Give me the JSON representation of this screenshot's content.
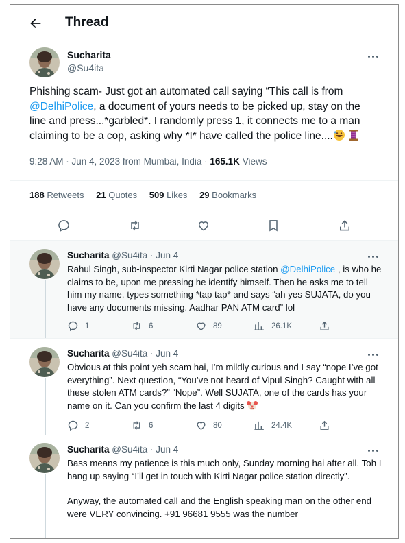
{
  "header": {
    "title": "Thread"
  },
  "main_tweet": {
    "name": "Sucharita",
    "handle": "@Su4ita",
    "text_pre": "Phishing scam- Just got an automated call saying “This call is from ",
    "mention": "@DelhiPolice",
    "text_post": ", a document of yours needs to be picked up, stay on the line and press...*garbled*. I randomly press 1, it connects me to a man claiming to be a cop, asking why *I* have called the police line....",
    "emojis": [
      "rofl-emoji",
      "thread-emoji"
    ],
    "timestamp": "9:28 AM · Jun 4, 2023 from Mumbai, India · ",
    "views_count": "165.1K",
    "views_label": " Views",
    "stats": [
      {
        "count": "188",
        "label": " Retweets"
      },
      {
        "count": "21",
        "label": " Quotes"
      },
      {
        "count": "509",
        "label": " Likes"
      },
      {
        "count": "29",
        "label": " Bookmarks"
      }
    ],
    "actions": [
      "reply-icon",
      "retweet-icon",
      "like-icon",
      "bookmark-icon",
      "share-icon"
    ]
  },
  "replies": [
    {
      "name": "Sucharita",
      "handle": "@Su4ita · Jun 4",
      "text_pre": "Rahul Singh, sub-inspector Kirti Nagar police station ",
      "mention": "@DelhiPolice",
      "text_post": " , is who he claims to be, upon me pressing he identify himself. Then he asks me to tell him my name, types something *tap tap* and says “ah yes SUJATA, do you have any documents missing. Aadhar PAN ATM card” lol",
      "replies": "1",
      "retweets": "6",
      "likes": "89",
      "views": "26.1K"
    },
    {
      "name": "Sucharita",
      "handle": "@Su4ita · Jun 4",
      "text_pre": "Obvious at this point yeh scam hai, I’m mildly curious and I say “nope I’ve got everything”. Next question, “You’ve not heard of Vipul Singh? Caught with all these stolen ATM cards?” “Nope”. Well SUJATA, one of the cards has your name on it. Can you confirm the last 4 digits ",
      "mention": "",
      "text_post": "",
      "emoji": "clown-emoji",
      "replies": "2",
      "retweets": "6",
      "likes": "80",
      "views": "24.4K"
    },
    {
      "name": "Sucharita",
      "handle": "@Su4ita · Jun 4",
      "text_pre": "Bass means my patience is this much only, Sunday morning hai after all. Toh I hang up saying “I’ll get in touch with Kirti Nagar police station directly”.",
      "text_para2": "Anyway, the automated call and the English speaking man on the other end were VERY convincing. +91 96681 9555 was the number",
      "mention": "",
      "text_post": ""
    }
  ],
  "colors": {
    "accent": "#1d9bf0",
    "text": "#0f1419",
    "muted": "#536471",
    "divider": "#eff3f4"
  }
}
